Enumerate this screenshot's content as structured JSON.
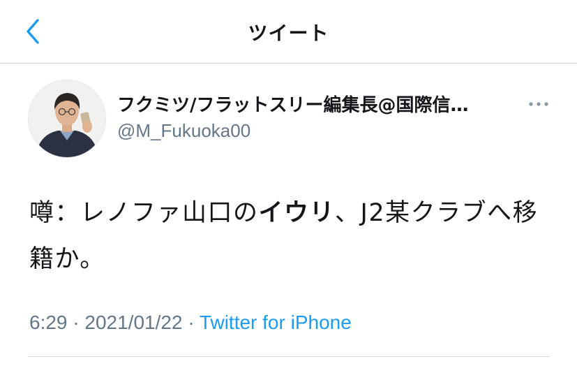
{
  "header": {
    "title": "ツイート",
    "back_icon": "chevron-left-icon",
    "accent_color": "#1d9bf0"
  },
  "tweet": {
    "author": {
      "display_name": "フクミツ/フラットスリー編集長@国際信…",
      "handle": "@M_Fukuoka00",
      "avatar_icon": "user-avatar"
    },
    "more_icon": "more-horizontal-icon",
    "text_segments": [
      {
        "text": "噂：レノファ山口の",
        "bold": false
      },
      {
        "text": "イウリ",
        "bold": true
      },
      {
        "text": "、J2某クラブへ移籍か。",
        "bold": false
      }
    ],
    "time": "6:29",
    "separator": "·",
    "date": "2021/01/22",
    "source": "Twitter for iPhone"
  }
}
